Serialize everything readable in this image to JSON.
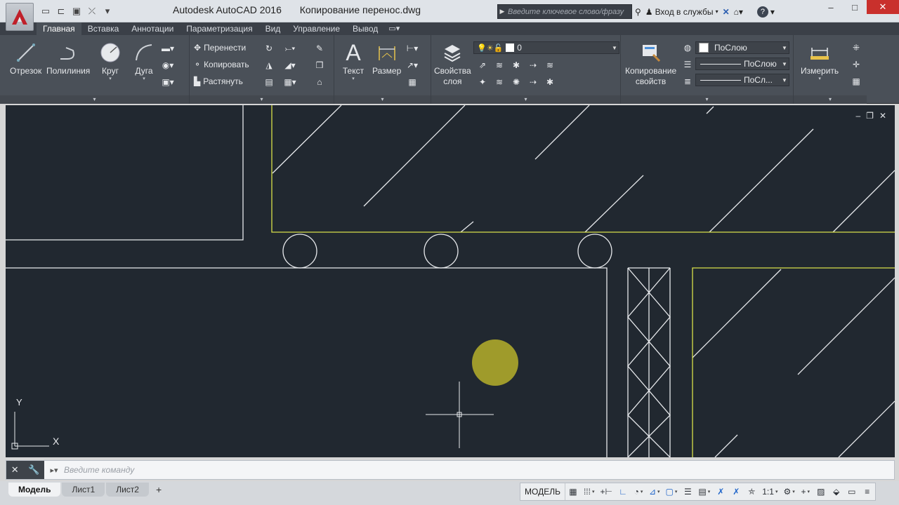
{
  "app": {
    "title": "Autodesk AutoCAD 2016",
    "file": "Копирование перенос.dwg"
  },
  "search": {
    "placeholder": "Введите ключевое слово/фразу"
  },
  "account": {
    "signin_label": "Вход в службы"
  },
  "ribbon_tabs": [
    "Главная",
    "Вставка",
    "Аннотации",
    "Параметризация",
    "Вид",
    "Управление",
    "Вывод"
  ],
  "draw_panel": {
    "line": "Отрезок",
    "polyline": "Полилиния",
    "circle": "Круг",
    "arc": "Дуга"
  },
  "modify_panel": {
    "move": "Перенести",
    "copy": "Копировать",
    "stretch": "Растянуть"
  },
  "annotation_panel": {
    "text": "Текст",
    "dimension": "Размер"
  },
  "layers_panel": {
    "layer_properties_line1": "Свойства",
    "layer_properties_line2": "слоя",
    "current_layer": "0"
  },
  "properties_panel": {
    "match_line1": "Копирование",
    "match_line2": "свойств",
    "color": "ПоСлою",
    "linetype": "ПоСлою",
    "lineweight": "ПоСл..."
  },
  "utilities_panel": {
    "measure": "Измерить"
  },
  "viewport": {
    "ucs_y": "Y",
    "ucs_x": "X",
    "colors": {
      "background": "#212830",
      "lines": "#e8eaed",
      "hatch_boundary": "#d8e04a",
      "highlight": "#c9c22a"
    }
  },
  "command": {
    "placeholder": "Введите команду"
  },
  "layout_tabs": [
    "Модель",
    "Лист1",
    "Лист2"
  ],
  "status": {
    "model": "МОДЕЛЬ",
    "scale": "1:1"
  }
}
